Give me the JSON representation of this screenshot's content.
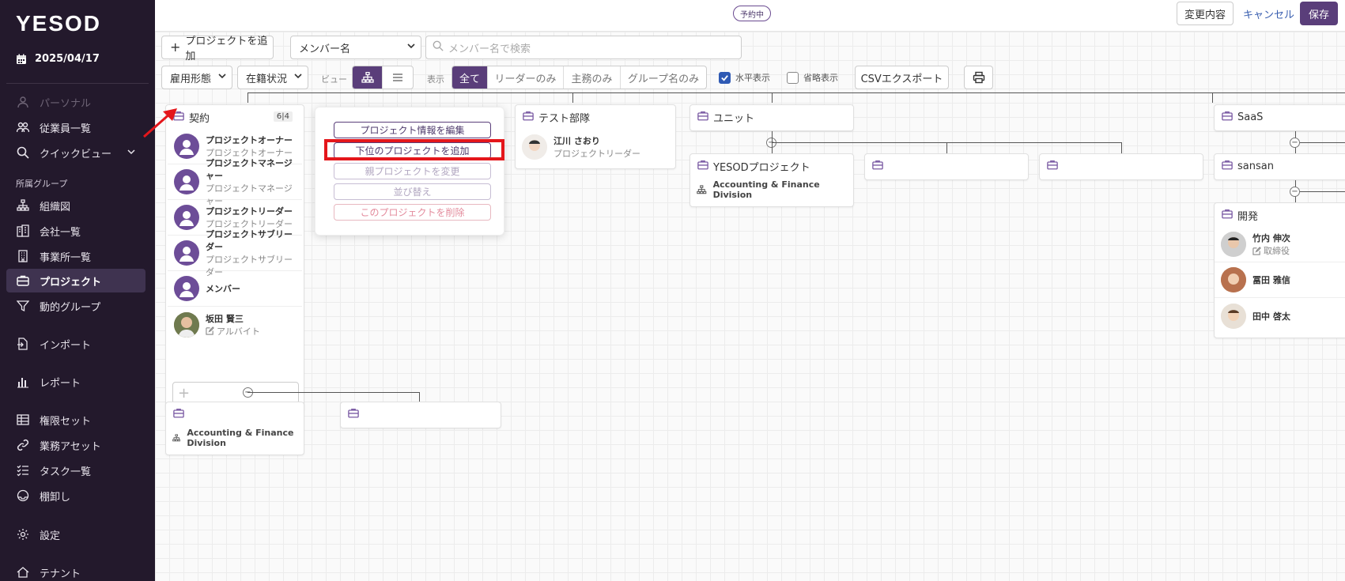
{
  "brand": {
    "logo": "YESOD",
    "accent": "#5a3e7a",
    "sidebar_bg": "#23192c"
  },
  "sidebar": {
    "date": "2025/04/17",
    "items": [
      {
        "label": "パーソナル",
        "icon": "person-icon"
      },
      {
        "label": "従業員一覧",
        "icon": "users-icon"
      },
      {
        "label": "クイックビュー",
        "icon": "search-icon"
      },
      {
        "label": "組織図",
        "icon": "org-chart-icon"
      },
      {
        "label": "会社一覧",
        "icon": "company-icon"
      },
      {
        "label": "事業所一覧",
        "icon": "building-icon"
      },
      {
        "label": "プロジェクト",
        "icon": "briefcase-icon"
      },
      {
        "label": "動的グループ",
        "icon": "filter-icon"
      },
      {
        "label": "インポート",
        "icon": "import-icon"
      },
      {
        "label": "レポート",
        "icon": "report-icon"
      },
      {
        "label": "権限セット",
        "icon": "grid-icon"
      },
      {
        "label": "業務アセット",
        "icon": "link-icon"
      },
      {
        "label": "タスク一覧",
        "icon": "task-list-icon"
      },
      {
        "label": "棚卸し",
        "icon": "inventory-icon"
      },
      {
        "label": "設定",
        "icon": "gear-icon"
      },
      {
        "label": "テナント",
        "icon": "tenant-icon"
      }
    ],
    "section_label": "所属グループ"
  },
  "header": {
    "status_badge": "予約中",
    "changes_button": "変更内容",
    "cancel_button": "キャンセル",
    "save_button": "保存"
  },
  "toolbar": {
    "add_project": "プロジェクトを追加",
    "member_select": "メンバー名",
    "search_placeholder": "メンバー名で検索",
    "employment_type": "雇用形態",
    "enrollment_status": "在籍状況",
    "view_label": "ビュー",
    "display_label": "表示",
    "display_options": [
      "全て",
      "リーダーのみ",
      "主務のみ",
      "グループ名のみ"
    ],
    "horizontal_label": "水平表示",
    "abbrev_label": "省略表示",
    "csv_export": "CSVエクスポート"
  },
  "cards": {
    "keiyaku": {
      "title": "契約",
      "count": "6|4",
      "members": [
        {
          "name": "プロジェクトオーナー",
          "role": "プロジェクトオーナー"
        },
        {
          "name": "プロジェクトマネージャー",
          "role": "プロジェクトマネージャー"
        },
        {
          "name": "プロジェクトリーダー",
          "role": "プロジェクトリーダー"
        },
        {
          "name": "プロジェクトサブリーダー",
          "role": "プロジェクトサブリーダー"
        },
        {
          "name": "メンバー",
          "role": ""
        },
        {
          "name": "坂田 賢三",
          "role": "アルバイト"
        }
      ]
    },
    "test_butai": {
      "title": "テスト部隊",
      "member_name": "江川 さおり",
      "member_role": "プロジェクトリーダー"
    },
    "unit": {
      "title": "ユニット"
    },
    "yesod_project": {
      "title": "YESODプロジェクト",
      "division": "Accounting & Finance Division"
    },
    "saas": {
      "title": "SaaS"
    },
    "sansan": {
      "title": "sansan"
    },
    "kaihatsu": {
      "title": "開発",
      "members": [
        {
          "name": "竹内 伸次",
          "role": "取締役"
        },
        {
          "name": "冨田 雅信",
          "role": ""
        },
        {
          "name": "田中 啓太",
          "role": ""
        }
      ]
    },
    "child_division": "Accounting & Finance Division"
  },
  "context_menu": {
    "edit": "プロジェクト情報を編集",
    "add_child": "下位のプロジェクトを追加",
    "change_parent": "親プロジェクトを変更",
    "reorder": "並び替え",
    "delete": "このプロジェクトを削除"
  }
}
